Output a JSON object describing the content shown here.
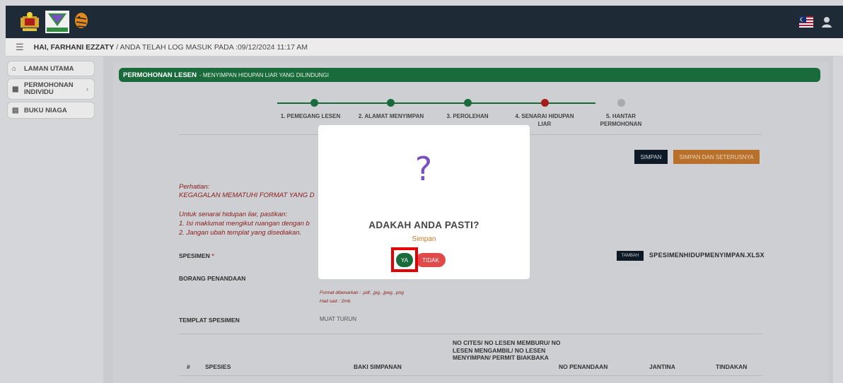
{
  "welcome": {
    "user": "HAI, FARHANI EZZATY",
    "login_text": "/ ANDA TELAH LOG MASUK PADA :09/12/2024 11:17 AM"
  },
  "sidebar": {
    "items": [
      {
        "label": "LAMAN UTAMA",
        "icon": "home-icon"
      },
      {
        "label": "PERMOHONAN INDIVIDU",
        "icon": "grid-icon"
      },
      {
        "label": "BUKU NIAGA",
        "icon": "document-icon"
      }
    ]
  },
  "page": {
    "title": "PERMOHONAN LESEN",
    "subtitle": "- MENYIMPAN HIDUPAN LIAR YANG DILINDUNGI"
  },
  "steps": [
    {
      "label": "1. PEMEGANG LESEN",
      "status": "done"
    },
    {
      "label": "2. ALAMAT MENYIMPAN",
      "status": "done"
    },
    {
      "label": "3. PEROLEHAN",
      "status": "done"
    },
    {
      "label": "4. SENARAI HIDUPAN LIAR",
      "status": "current"
    },
    {
      "label": "5. HANTAR PERMOHONAN",
      "status": "pending"
    }
  ],
  "buttons": {
    "simpan": "SIMPAN",
    "simpan_next": "SIMPAN DAN SETERUSNYA",
    "tambah": "TAMBAH"
  },
  "notes": {
    "perhatian": "Perhatian:",
    "warning": "KEGAGALAN MEMATUHI FORMAT YANG D",
    "instr_head": "Untuk senarai hidupan liar, pastikan:",
    "instr1": "1. Isi maklumat mengikut ruangan dengan b",
    "instr2": "2. Jangan ubah templat yang disediakan."
  },
  "fields": {
    "spesimen": "SPESIMEN",
    "spesimen_file": "SPESIMENHIDUPMENYIMPAN.XLSX",
    "borang": "BORANG PENANDAAN",
    "format_hint": "Format dibenarkan : .pdf, .jpg, .jpeg, .png",
    "size_hint": "Had saiz : 2mb",
    "templat": "TEMPLAT SPESIMEN",
    "muat_turun": "MUAT TURUN"
  },
  "table": {
    "headers": [
      "#",
      "SPESIES",
      "BAKI SIMPANAN",
      "NO CITES/ NO LESEN MEMBURU/ NO LESEN MENGAMBIL/ NO LESEN MENYIMPAN/ PERMIT BIAKBAKA",
      "NO PENANDAAN",
      "JANTINA",
      "TINDAKAN"
    ]
  },
  "modal": {
    "title": "ADAKAH ANDA PASTI?",
    "subtitle": "Simpan",
    "yes": "YA",
    "no": "TIDAK",
    "icon": "question-icon"
  },
  "colors": {
    "brand_green": "#1a6b3c",
    "danger": "#e04a4a",
    "accent_orange": "#cc7a28"
  }
}
